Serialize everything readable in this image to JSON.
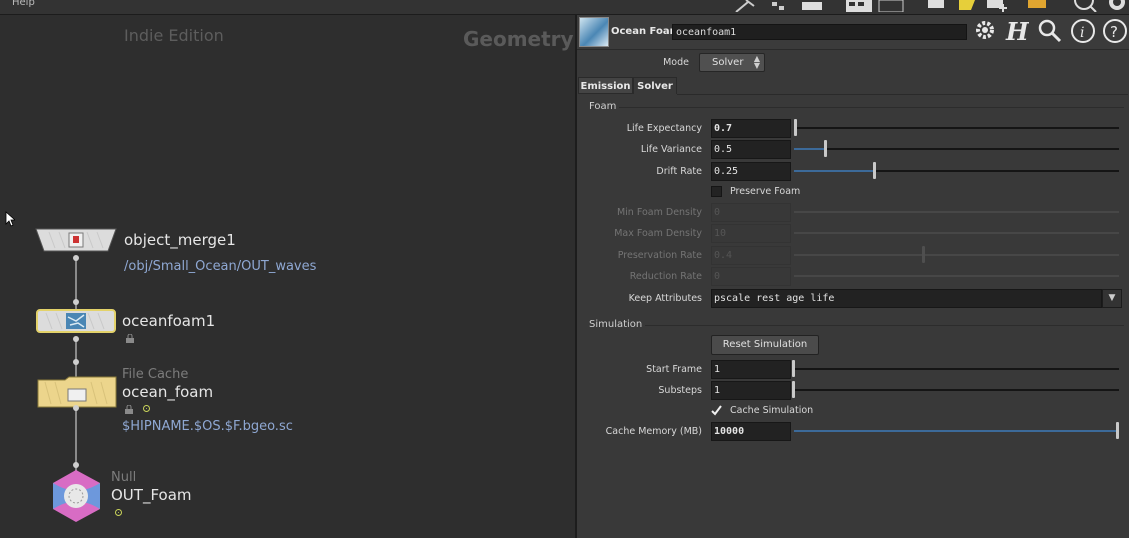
{
  "menu": {
    "help": "Help"
  },
  "network": {
    "watermark_edition": "Indie Edition",
    "watermark_context": "Geometry",
    "nodes": {
      "object_merge": {
        "name": "object_merge1",
        "path": "/obj/Small_Ocean/OUT_waves"
      },
      "oceanfoam": {
        "name": "oceanfoam1"
      },
      "filecache": {
        "type": "File Cache",
        "name": "ocean_foam",
        "path": "$HIPNAME.$OS.$F.bgeo.sc"
      },
      "null": {
        "type": "Null",
        "name": "OUT_Foam"
      }
    }
  },
  "params": {
    "node_type": "Ocean Foam",
    "node_name": "oceanfoam1",
    "mode_label": "Mode",
    "mode_value": "Solver",
    "tabs": [
      "Emission",
      "Solver"
    ],
    "active_tab": "Solver",
    "foam": {
      "section": "Foam",
      "life_expectancy": {
        "label": "Life Expectancy",
        "value": "0.7",
        "fraction": 0.0
      },
      "life_variance": {
        "label": "Life Variance",
        "value": "0.5",
        "fraction": 0.1
      },
      "drift_rate": {
        "label": "Drift Rate",
        "value": "0.25",
        "fraction": 0.25
      },
      "preserve_foam": {
        "label": "Preserve Foam",
        "checked": false
      },
      "min_foam_density": {
        "label": "Min Foam Density",
        "value": "0"
      },
      "max_foam_density": {
        "label": "Max Foam Density",
        "value": "10"
      },
      "preservation_rate": {
        "label": "Preservation Rate",
        "value": "0.4"
      },
      "reduction_rate": {
        "label": "Reduction Rate",
        "value": "0"
      },
      "keep_attributes": {
        "label": "Keep Attributes",
        "value": "pscale rest age life"
      }
    },
    "simulation": {
      "section": "Simulation",
      "reset_button": "Reset Simulation",
      "start_frame": {
        "label": "Start Frame",
        "value": "1"
      },
      "substeps": {
        "label": "Substeps",
        "value": "1"
      },
      "cache_simulation": {
        "label": "Cache Simulation",
        "checked": true
      },
      "cache_memory": {
        "label": "Cache Memory (MB)",
        "value": "10000",
        "fraction": 1.0
      }
    }
  },
  "colors": {
    "accent_blue": "#3c6a99",
    "path_blue": "#8fa8d3",
    "selected_outline": "#e3d26a"
  }
}
